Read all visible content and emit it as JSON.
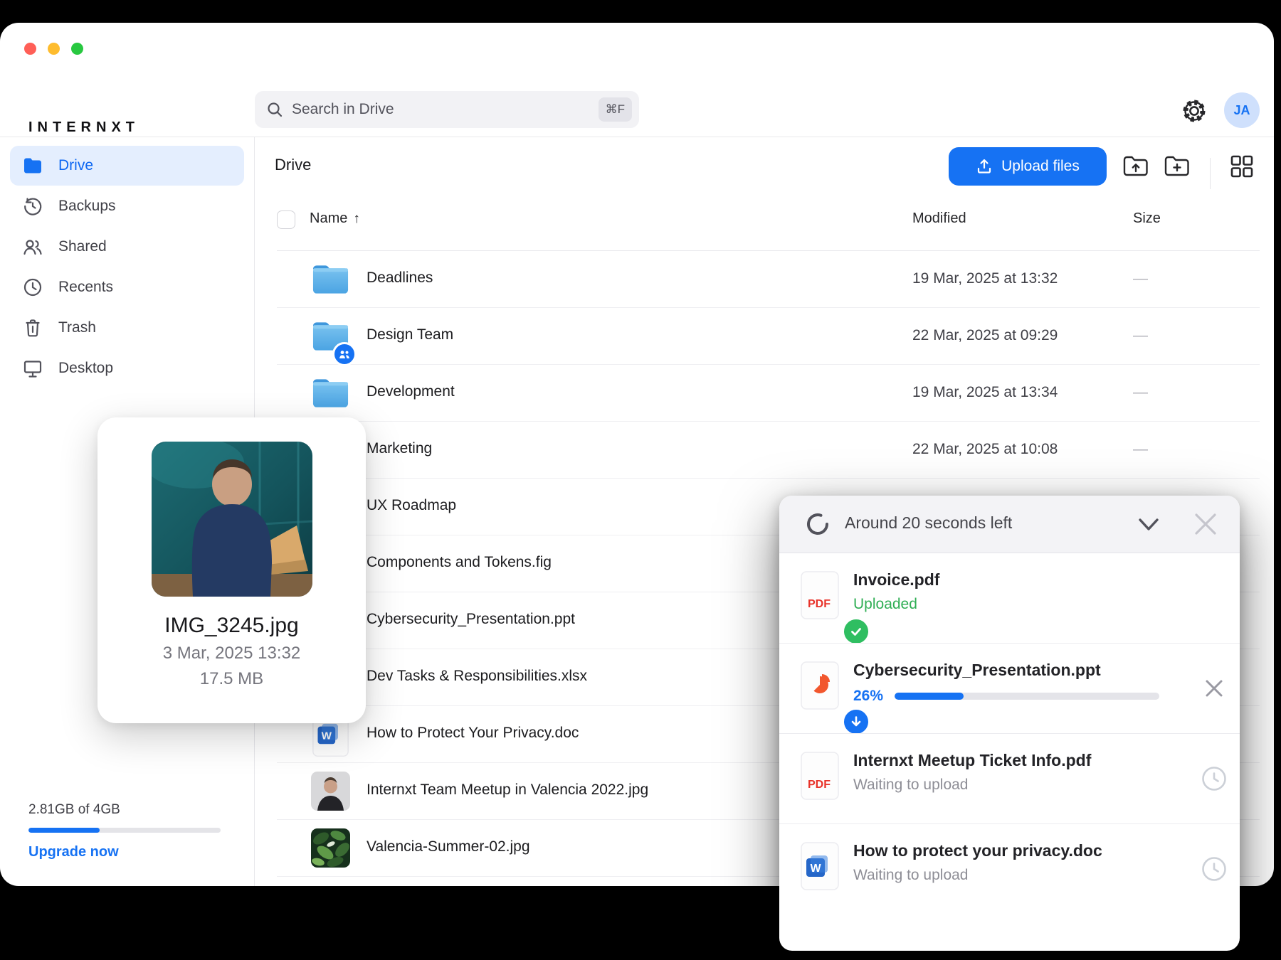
{
  "brand": {
    "logo": "INTERNXT"
  },
  "search": {
    "placeholder": "Search in Drive",
    "shortcut": "⌘F"
  },
  "header": {
    "avatar_initials": "JA"
  },
  "toolbar": {
    "page_title": "Drive",
    "upload_button": "Upload files"
  },
  "table": {
    "columns": {
      "name": "Name",
      "modified": "Modified",
      "size": "Size"
    },
    "sort_indicator": "↑",
    "rows": [
      {
        "name": "Deadlines",
        "type": "folder",
        "shared": false,
        "modified": "19 Mar, 2025 at 13:32",
        "size": "—"
      },
      {
        "name": "Design Team",
        "type": "folder",
        "shared": true,
        "modified": "22 Mar, 2025 at 09:29",
        "size": "—"
      },
      {
        "name": "Development",
        "type": "folder",
        "shared": false,
        "modified": "19 Mar, 2025 at 13:34",
        "size": "—"
      },
      {
        "name": "Marketing",
        "type": "folder",
        "shared": false,
        "modified": "22 Mar, 2025 at 10:08",
        "size": "—"
      },
      {
        "name": "UX Roadmap",
        "type": "folder",
        "shared": false,
        "modified": "",
        "size": ""
      },
      {
        "name": "Components and Tokens.fig",
        "type": "fig",
        "shared": false,
        "modified": "",
        "size": ""
      },
      {
        "name": "Cybersecurity_Presentation.ppt",
        "type": "ppt",
        "shared": false,
        "modified": "",
        "size": ""
      },
      {
        "name": "Dev Tasks & Responsibilities.xlsx",
        "type": "xlsx",
        "shared": false,
        "modified": "",
        "size": ""
      },
      {
        "name": "How to Protect Your Privacy.doc",
        "type": "doc",
        "shared": false,
        "modified": "",
        "size": ""
      },
      {
        "name": "Internxt Team Meetup in Valencia 2022.jpg",
        "type": "img-portrait",
        "shared": false,
        "modified": "",
        "size": ""
      },
      {
        "name": "Valencia-Summer-02.jpg",
        "type": "img-leaves",
        "shared": false,
        "modified": "",
        "size": ""
      }
    ]
  },
  "sidebar": {
    "items": [
      {
        "label": "Drive",
        "icon": "drive",
        "active": true
      },
      {
        "label": "Backups",
        "icon": "backups",
        "active": false
      },
      {
        "label": "Shared",
        "icon": "shared",
        "active": false
      },
      {
        "label": "Recents",
        "icon": "recents",
        "active": false
      },
      {
        "label": "Trash",
        "icon": "trash",
        "active": false
      },
      {
        "label": "Desktop",
        "icon": "desktop",
        "active": false
      }
    ],
    "storage": {
      "usage_label": "2.81GB of 4GB",
      "percent": 37,
      "upgrade_label": "Upgrade now"
    }
  },
  "preview_card": {
    "filename": "IMG_3245.jpg",
    "date": "3 Mar, 2025 13:32",
    "size": "17.5 MB"
  },
  "upload_panel": {
    "title": "Around 20 seconds left",
    "items": [
      {
        "name": "Invoice.pdf",
        "icon": "pdf",
        "status_type": "done",
        "status": "Uploaded"
      },
      {
        "name": "Cybersecurity_Presentation.ppt",
        "icon": "ppt",
        "status_type": "progress",
        "percent_label": "26%",
        "percent": 26
      },
      {
        "name": "Internxt Meetup Ticket Info.pdf",
        "icon": "pdf",
        "status_type": "waiting",
        "status": "Waiting to upload"
      },
      {
        "name": "How to protect your privacy.doc",
        "icon": "doc",
        "status_type": "waiting",
        "status": "Waiting to upload"
      }
    ]
  },
  "colors": {
    "accent_blue": "#1672f3",
    "success_green": "#2fae54",
    "folder_blue": "#54aae6",
    "pdf_red": "#e8332a",
    "ppt_orange": "#f2572e",
    "word_blue": "#2566c8"
  }
}
